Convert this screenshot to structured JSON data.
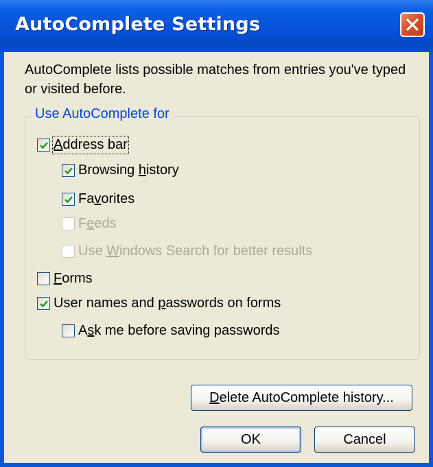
{
  "window": {
    "title": "AutoComplete Settings"
  },
  "description": "AutoComplete lists possible matches from entries you've typed or visited before.",
  "group": {
    "legend": "Use AutoComplete for",
    "items": [
      {
        "pre": "",
        "key": "A",
        "post": "ddress bar",
        "checked": true,
        "enabled": true
      },
      {
        "pre": "Browsing ",
        "key": "h",
        "post": "istory",
        "checked": true,
        "enabled": true
      },
      {
        "pre": "Fa",
        "key": "v",
        "post": "orites",
        "checked": true,
        "enabled": true
      },
      {
        "pre": "F",
        "key": "e",
        "post": "eds",
        "checked": false,
        "enabled": false
      },
      {
        "pre": "Use ",
        "key": "W",
        "post": "indows Search for better results",
        "checked": false,
        "enabled": false
      },
      {
        "pre": "",
        "key": "F",
        "post": "orms",
        "checked": false,
        "enabled": true
      },
      {
        "pre": "User names and ",
        "key": "p",
        "post": "asswords on forms",
        "checked": true,
        "enabled": true
      },
      {
        "pre": "A",
        "key": "s",
        "post": "k me before saving passwords",
        "checked": false,
        "enabled": true
      }
    ]
  },
  "buttons": {
    "delete_pre": "",
    "delete_key": "D",
    "delete_post": "elete AutoComplete history...",
    "ok": "OK",
    "cancel": "Cancel"
  },
  "colors": {
    "title_bar": "#0752d8",
    "client_bg": "#ece9d8",
    "legend_text": "#0046d5",
    "close_button": "#d9522c",
    "disabled_text": "#aca899"
  }
}
